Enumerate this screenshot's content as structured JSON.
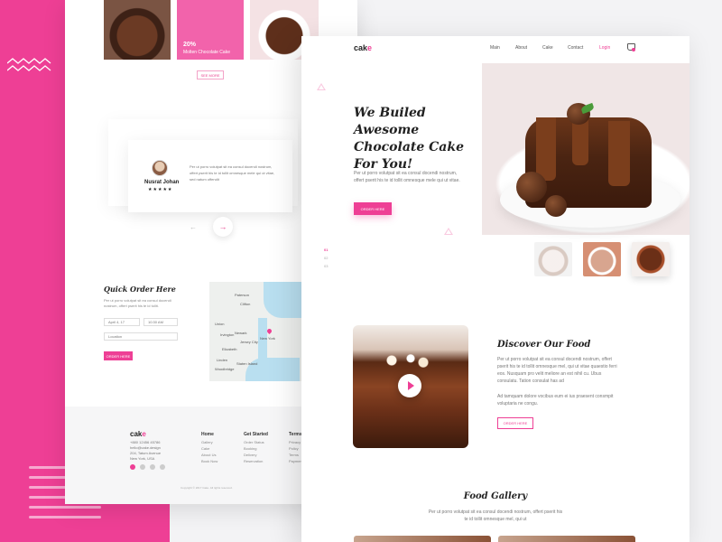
{
  "colors": {
    "accent": "#ee3f95",
    "background": "#f3f3f5",
    "panel": "#ffffff"
  },
  "back_page": {
    "featured": {
      "percent": "20%",
      "name": "Molten Chocolate Cake"
    },
    "see_more_label": "SEE MORE",
    "testimonial": {
      "name": "Nusrat Johan",
      "stars": "★★★★★",
      "text": "Per ut porro volutpat sit ea consul docendi nostrum, offert pserit his te id tollit omnesque mele qui ut vitae, sed natum offendit"
    },
    "slider": {
      "prev": "←",
      "next": "→"
    },
    "quick_order": {
      "title": "Quick Order Here",
      "text": "Per ut porro volutpat sit ea consul docendi nostrum, offert pserit his te id tollit.",
      "date_field": "April 4, 17",
      "time_field": "10:30 AM",
      "location_field": "Location",
      "button": "ORDER HERE"
    },
    "map": {
      "labels": [
        "Paterson",
        "Clifton",
        "Newark",
        "Jersey City",
        "New York",
        "Elizabeth",
        "Linden",
        "Woodbridge",
        "Staten Island",
        "Union",
        "Irvington"
      ]
    },
    "footer": {
      "logo_main": "cak",
      "logo_accent": "e",
      "contact": [
        "+880 12456 45786",
        "hello@cake.design",
        "204, Tatum Avenue",
        "New York, USA"
      ],
      "columns": [
        {
          "title": "Home",
          "items": [
            "Gallery",
            "Cake",
            "About Us",
            "Book Now"
          ]
        },
        {
          "title": "Get Started",
          "items": [
            "Order Status",
            "Booking",
            "Delivery",
            "Reservation"
          ]
        },
        {
          "title": "Terms",
          "items": [
            "Privacy",
            "Policy",
            "Terms",
            "Payment"
          ]
        }
      ],
      "copyright": "Copyright © 2017 Cake. All rights reserved."
    }
  },
  "front_page": {
    "logo_main": "cak",
    "logo_accent": "e",
    "nav": [
      "Main",
      "About",
      "Cake",
      "Contact"
    ],
    "login": "Login",
    "hero": {
      "title": "We Builed Awesome Chocolate Cake For You!",
      "text": "Per ut porro volutpat sit ea consul docendi nostrum, offert pserit his te id tollit omnesque mele qui ut vitae.",
      "button": "ORDER HERE"
    },
    "slides": [
      "01",
      "02",
      "03"
    ],
    "discover": {
      "title": "Discover Our Food",
      "text": "Per ut porro volutpat sit ea consul docendi nostrum, offert pserit his te id tollit omnesque mel, qui ut vitae quaestio ferri eos. Nusquam pro velit meliore an est nihil cu. Ubus consulatu. Tation consulat has ad",
      "text2": "Ad tamquam dolore vocibus eum ei ius praesent consmpit voluptaria ne congu.",
      "button": "ORDER HERE"
    },
    "gallery": {
      "title": "Food Gallery",
      "text": "Per ut porro volutpat sit ea consul docendi nostrum, offert pserit his te id tollit omnesque mel, qui ut"
    }
  }
}
